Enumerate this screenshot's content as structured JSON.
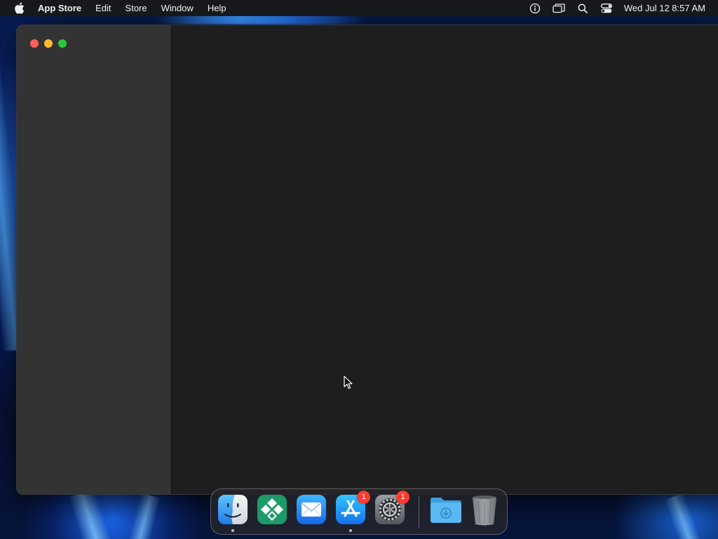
{
  "menubar": {
    "app_name": "App Store",
    "menus": [
      "Edit",
      "Store",
      "Window",
      "Help"
    ],
    "status_icons": [
      "accessibility-icon",
      "screen-mirroring-icon",
      "spotlight-search-icon",
      "control-center-icon"
    ],
    "clock": "Wed Jul 12  8:57 AM"
  },
  "window": {
    "traffic_lights": [
      "close",
      "minimize",
      "zoom"
    ],
    "colors": {
      "close": "#ff5f57",
      "minimize": "#febc2e",
      "zoom": "#28c840",
      "sidebar": "#333333",
      "content": "#1e1e1e"
    }
  },
  "dock": {
    "apps": [
      {
        "name": "Finder",
        "icon": "finder-icon",
        "running": true
      },
      {
        "name": "Tableau",
        "icon": "diamond-app-icon",
        "running": false
      },
      {
        "name": "Mail",
        "icon": "mail-icon",
        "running": false
      },
      {
        "name": "App Store",
        "icon": "app-store-icon",
        "running": true,
        "badge": "1"
      },
      {
        "name": "System Settings",
        "icon": "settings-gear-icon",
        "running": false,
        "badge": "1"
      }
    ],
    "others": [
      {
        "name": "Downloads",
        "icon": "downloads-folder-icon"
      },
      {
        "name": "Trash",
        "icon": "trash-icon"
      }
    ]
  }
}
